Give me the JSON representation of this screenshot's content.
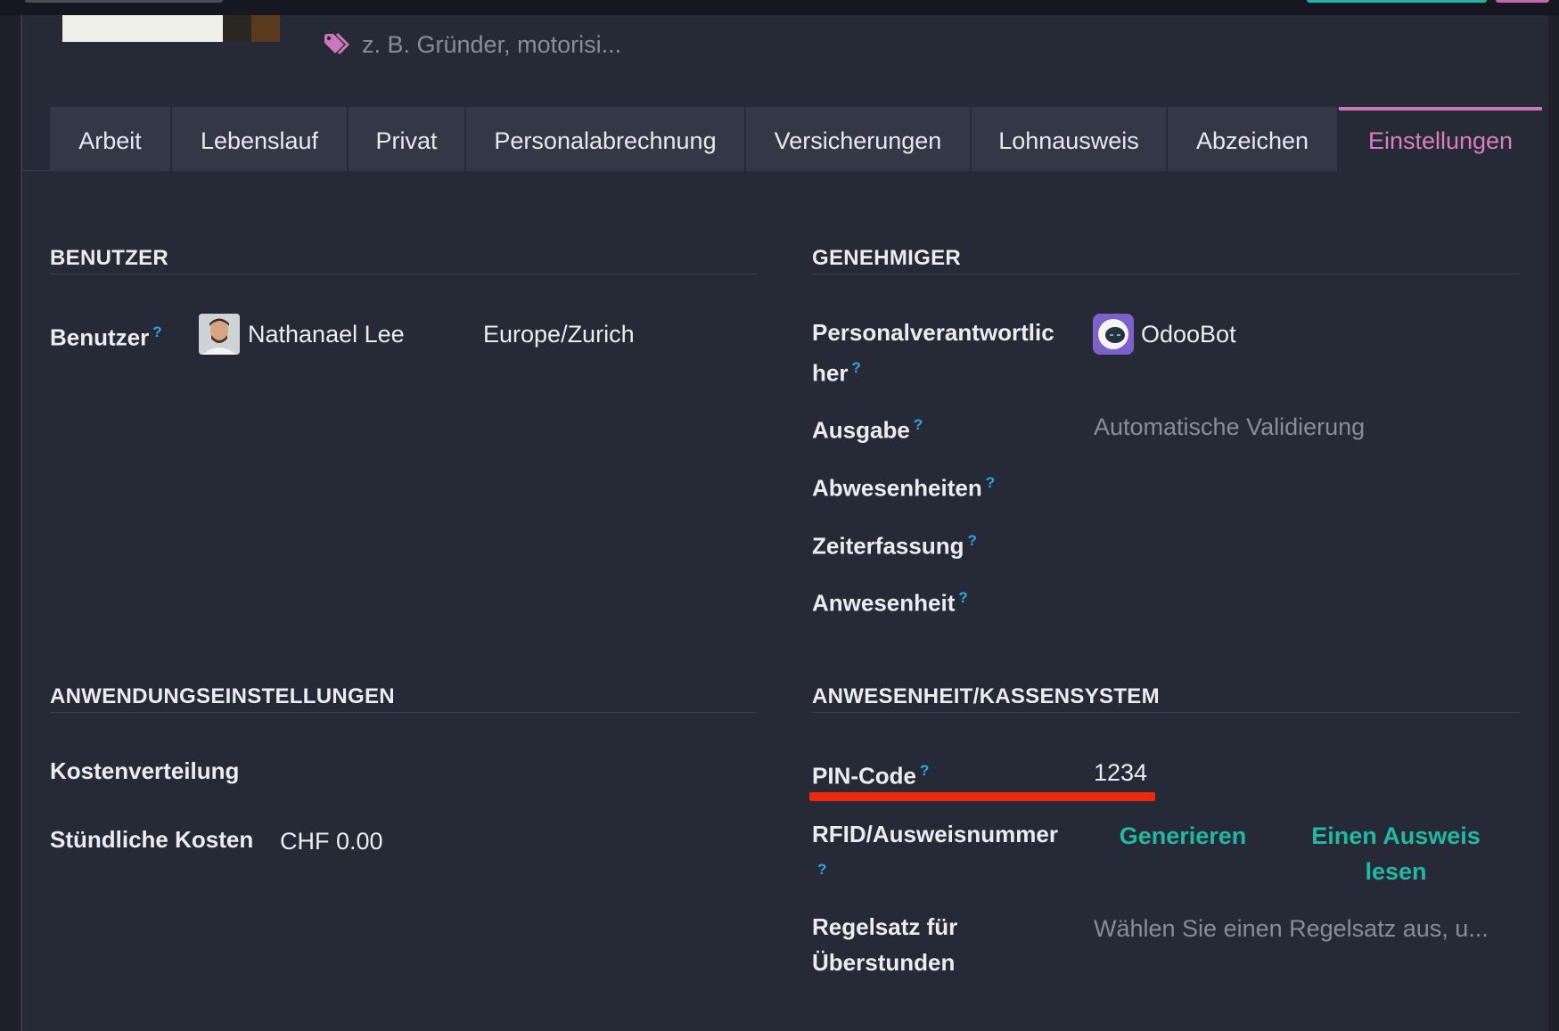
{
  "header": {
    "tags_placeholder": "z. B. Gründer, motorisi..."
  },
  "tabs": [
    {
      "label": "Arbeit"
    },
    {
      "label": "Lebenslauf"
    },
    {
      "label": "Privat"
    },
    {
      "label": "Personalabrechnung"
    },
    {
      "label": "Versicherungen"
    },
    {
      "label": "Lohnausweis"
    },
    {
      "label": "Abzeichen"
    },
    {
      "label": "Einstellungen",
      "active": true
    }
  ],
  "benutzer": {
    "title": "BENUTZER",
    "user_label": "Benutzer",
    "help": "?",
    "user_name": "Nathanael Lee",
    "timezone": "Europe/Zurich"
  },
  "genehmiger": {
    "title": "GENEHMIGER",
    "hr_label_line1": "Personalverantwortlic",
    "hr_label_line2": "her",
    "hr_value": "OdooBot",
    "ausgabe_label": "Ausgabe",
    "ausgabe_value": "Automatische Validierung",
    "abwesenheiten_label": "Abwesenheiten",
    "zeiterfassung_label": "Zeiterfassung",
    "anwesenheit_label": "Anwesenheit",
    "help": "?"
  },
  "app_settings": {
    "title": "ANWENDUNGSEINSTELLUNGEN",
    "cost_dist_label": "Kostenverteilung",
    "hourly_cost_label": "Stündliche Kosten",
    "hourly_cost_value": "CHF 0.00"
  },
  "attendance": {
    "title": "ANWESENHEIT/KASSENSYSTEM",
    "pin_label": "PIN-Code",
    "pin_value": "1234",
    "rfid_label": "RFID/Ausweisnummer",
    "generate_label": "Generieren",
    "read_badge_line1": "Einen Ausweis",
    "read_badge_line2": "lesen",
    "overtime_label_line1": "Regelsatz für",
    "overtime_label_line2": "Überstunden",
    "overtime_placeholder": "Wählen Sie einen Regelsatz aus, u...",
    "help": "?"
  },
  "colors": {
    "accent_pink": "#c979b5",
    "link_teal": "#22b8a3",
    "help_blue": "#2fa7e0",
    "highlight_red": "#f0260d"
  }
}
